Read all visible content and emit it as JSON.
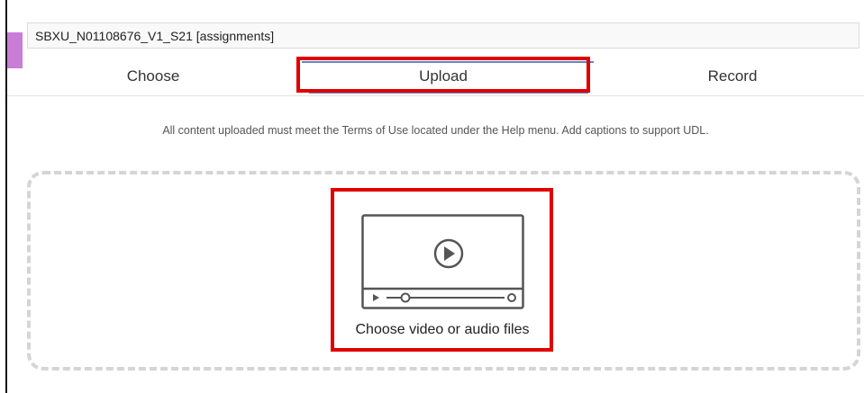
{
  "media_title": "SBXU_N01108676_V1_S21 [assignments]",
  "tabs": [
    {
      "label": "Choose",
      "active": false
    },
    {
      "label": "Upload",
      "active": true
    },
    {
      "label": "Record",
      "active": false
    }
  ],
  "notice": "All content uploaded must meet the Terms of Use located under the Help menu. Add captions to support UDL.",
  "dropzone": {
    "button_label": "Choose video or audio files",
    "icon": "video-player-icon"
  },
  "colors": {
    "accent": "#c97dd7",
    "highlight": "#e00000",
    "active_tab": "#5f86c6"
  }
}
